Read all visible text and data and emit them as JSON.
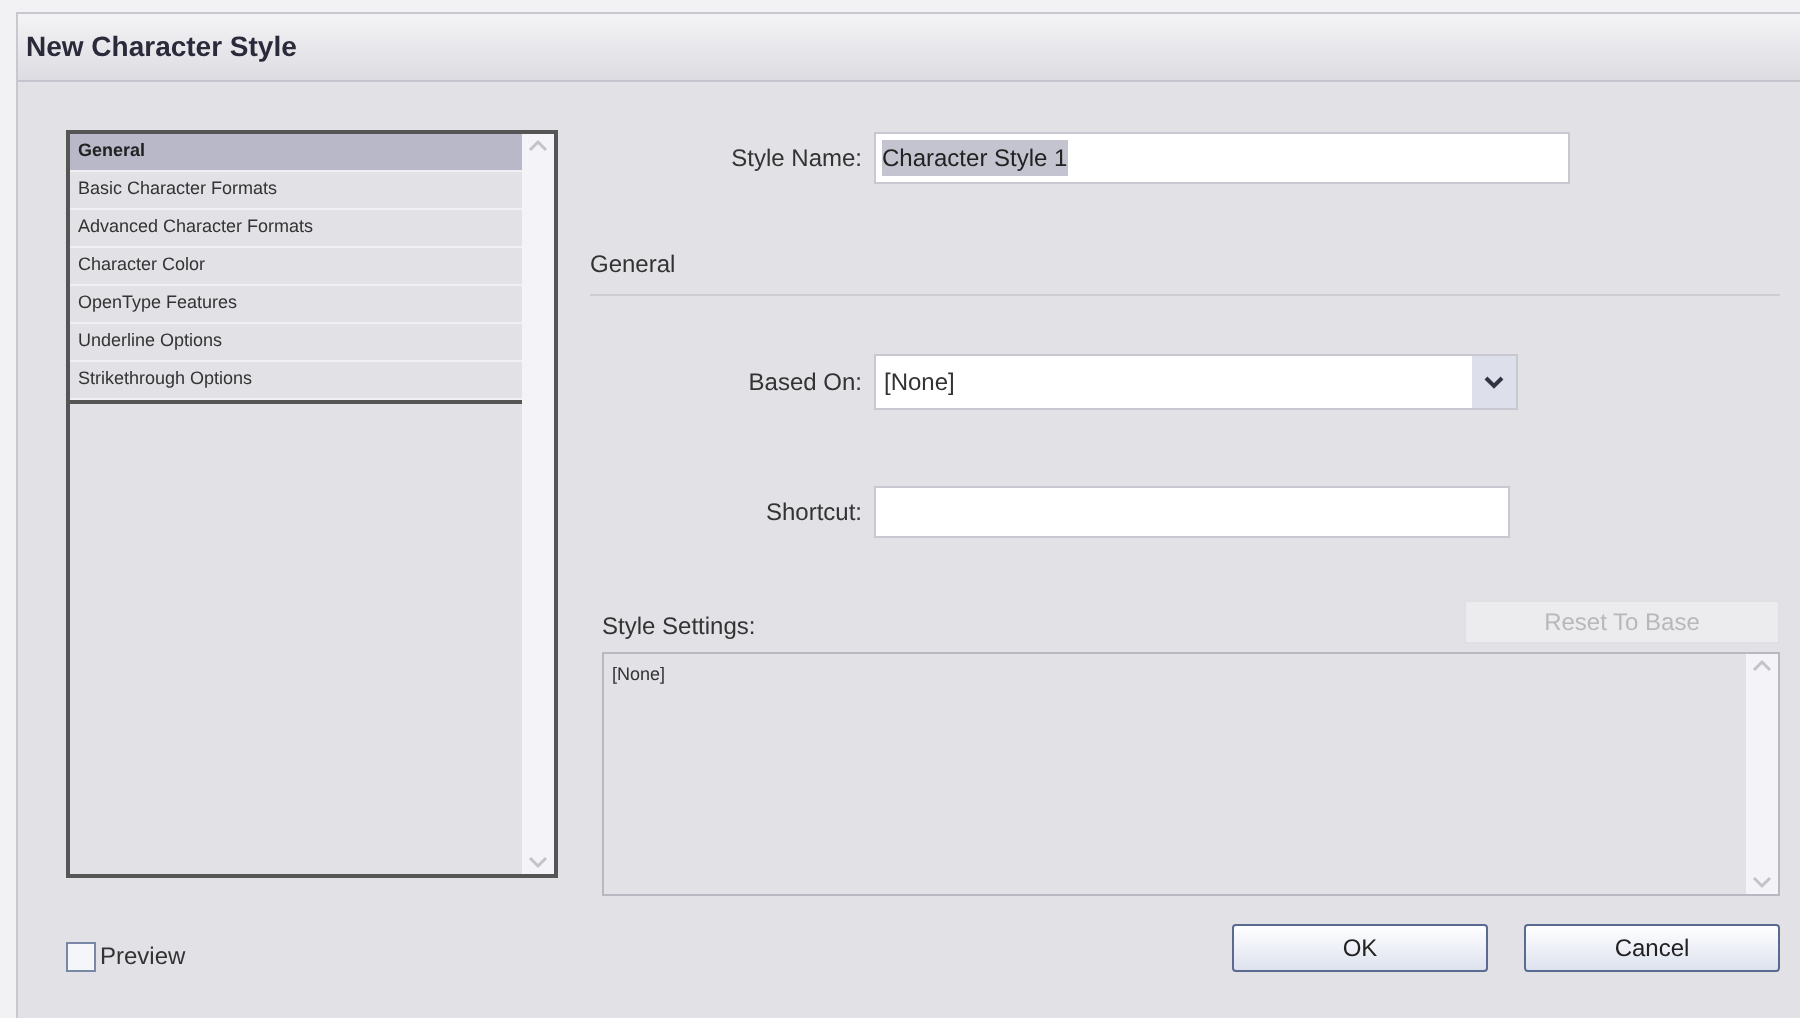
{
  "window": {
    "title": "New Character Style"
  },
  "categories": [
    {
      "label": "General",
      "selected": true
    },
    {
      "label": "Basic Character Formats",
      "selected": false
    },
    {
      "label": "Advanced Character Formats",
      "selected": false
    },
    {
      "label": "Character Color",
      "selected": false
    },
    {
      "label": "OpenType Features",
      "selected": false
    },
    {
      "label": "Underline Options",
      "selected": false
    },
    {
      "label": "Strikethrough Options",
      "selected": false
    }
  ],
  "style_name": {
    "label": "Style Name:",
    "value": "Character Style 1",
    "text_selected": true
  },
  "section_title": "General",
  "based_on": {
    "label": "Based On:",
    "value": "[None]"
  },
  "shortcut": {
    "label": "Shortcut:"
  },
  "style_settings": {
    "label": "Style Settings:",
    "reset_button": {
      "label": "Reset To Base",
      "disabled": true
    },
    "text": "[None]"
  },
  "preview": {
    "label": "Preview",
    "checked": false
  },
  "buttons": [
    "OK",
    "Cancel"
  ]
}
